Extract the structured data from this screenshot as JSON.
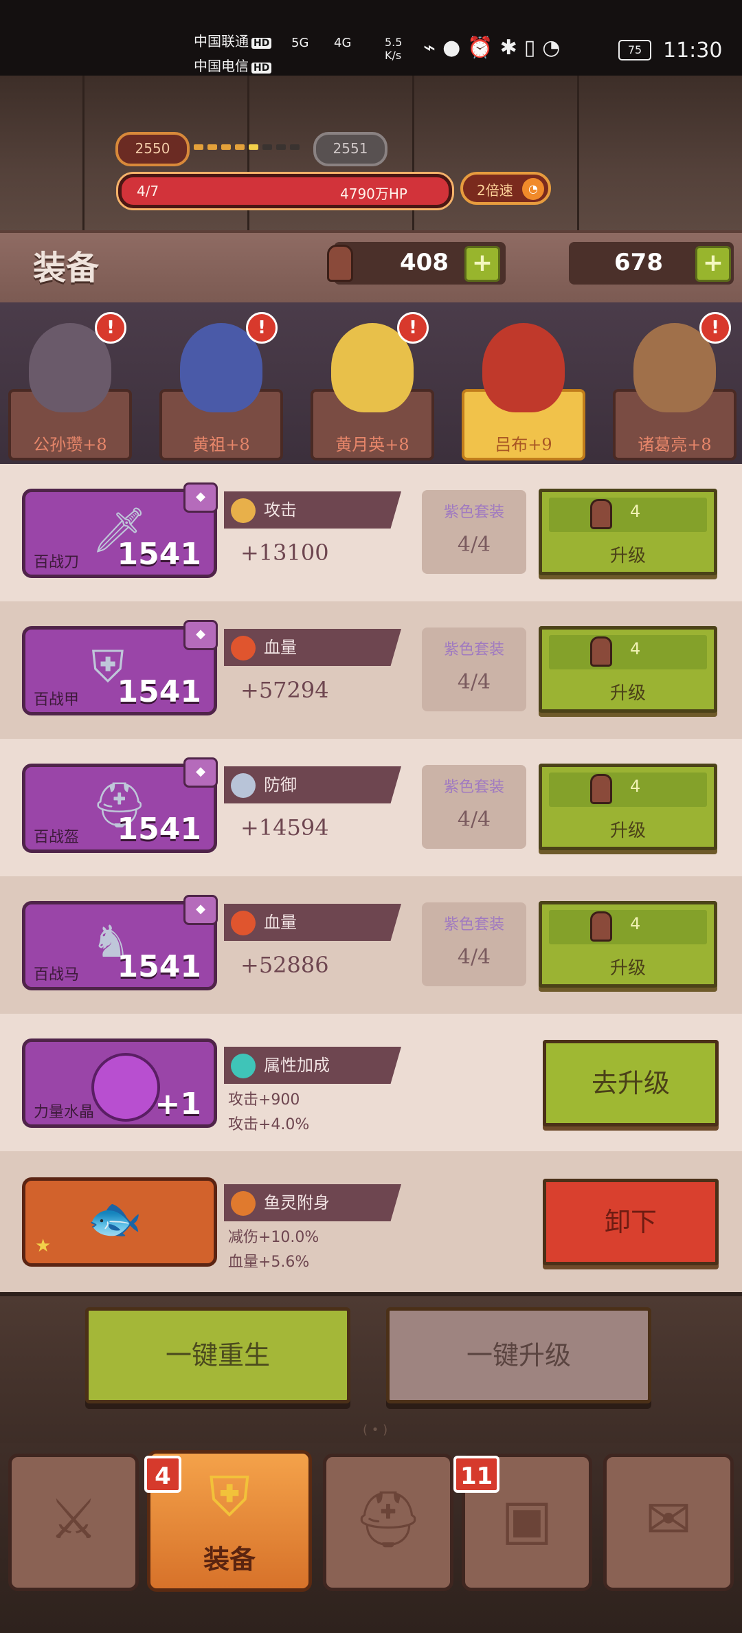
{
  "status_bar": {
    "carrier1": "中国联通",
    "carrier2": "中国电信",
    "hd": "HD",
    "net1": "5G",
    "net2": "4G",
    "speed": "5.5 K/s",
    "battery": "75",
    "time": "11:30"
  },
  "progress": {
    "current_level": "2550",
    "next_level": "2551",
    "hp_left": "4/7",
    "hp_right": "4790万HP",
    "speed_label": "2倍速"
  },
  "equipment_header": {
    "title": "装备",
    "resource1": "408",
    "resource2": "678",
    "plus": "+"
  },
  "heroes": [
    {
      "name": "公孙瓒+8",
      "alert": "!",
      "selected": false,
      "color": "#6a5a6a"
    },
    {
      "name": "黄祖+8",
      "alert": "!",
      "selected": false,
      "color": "#4a5aa8"
    },
    {
      "name": "黄月英+8",
      "alert": "!",
      "selected": false,
      "color": "#e8c04a"
    },
    {
      "name": "吕布+9",
      "alert": "",
      "selected": true,
      "color": "#c0392b"
    },
    {
      "name": "诸葛亮+8",
      "alert": "!",
      "selected": false,
      "color": "#a0704a"
    }
  ],
  "equipment": [
    {
      "item": "百战刀",
      "level": "1541",
      "stat": "攻击",
      "value": "+13100",
      "set_label": "紫色套装",
      "set_count": "4/4",
      "cost": "4",
      "button": "升级",
      "icon": "sword-icon",
      "stat_color": "#e8b04a"
    },
    {
      "item": "百战甲",
      "level": "1541",
      "stat": "血量",
      "value": "+57294",
      "set_label": "紫色套装",
      "set_count": "4/4",
      "cost": "4",
      "button": "升级",
      "icon": "armor-icon",
      "stat_color": "#e0552e"
    },
    {
      "item": "百战盔",
      "level": "1541",
      "stat": "防御",
      "value": "+14594",
      "set_label": "紫色套装",
      "set_count": "4/4",
      "cost": "4",
      "button": "升级",
      "icon": "helmet-icon",
      "stat_color": "#b8c4d8"
    },
    {
      "item": "百战马",
      "level": "1541",
      "stat": "血量",
      "value": "+52886",
      "set_label": "紫色套装",
      "set_count": "4/4",
      "cost": "4",
      "button": "升级",
      "icon": "horse-icon",
      "stat_color": "#e0552e"
    }
  ],
  "crystal": {
    "item": "力量水晶",
    "level": "+1",
    "stat": "属性加成",
    "line1": "攻击+900",
    "line2": "攻击+4.0%",
    "button": "去升级"
  },
  "spirit": {
    "stat": "鱼灵附身",
    "line1": "减伤+10.0%",
    "line2": "血量+5.6%",
    "button": "卸下"
  },
  "bottom_buttons": {
    "rebirth": "一键重生",
    "upgrade_all": "一键升级",
    "dots": "( • )"
  },
  "tabs": [
    {
      "label": "",
      "badge": "",
      "icon": "battle-icon"
    },
    {
      "label": "装备",
      "badge": "4",
      "icon": "equipment-icon"
    },
    {
      "label": "",
      "badge": "",
      "icon": "helmet-tab-icon"
    },
    {
      "label": "",
      "badge": "11",
      "icon": "chest-icon"
    },
    {
      "label": "",
      "badge": "",
      "icon": "scroll-icon"
    }
  ]
}
